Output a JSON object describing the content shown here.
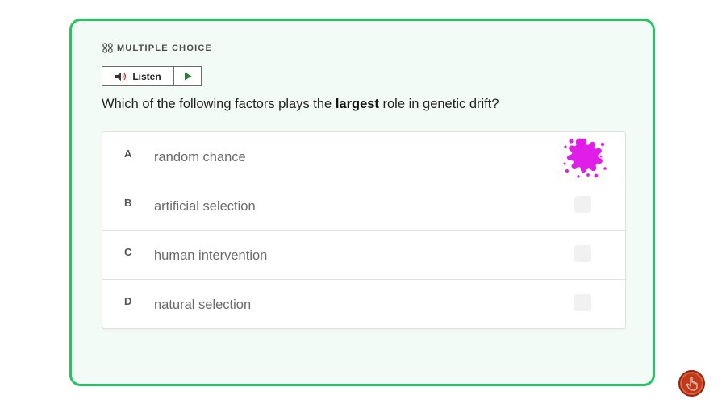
{
  "question_card": {
    "type_label": "MULTIPLE CHOICE",
    "type_icon": "grid-icon",
    "listen": {
      "label": "Listen",
      "speaker_icon": "speaker-icon",
      "play_icon": "play-icon"
    },
    "question": {
      "prefix": "Which of the following factors plays the ",
      "emphasis": "largest",
      "suffix": " role in genetic drift?"
    },
    "options": [
      {
        "letter": "A",
        "text": "random chance",
        "state": "splat-marked"
      },
      {
        "letter": "B",
        "text": "artificial selection",
        "state": "unchecked"
      },
      {
        "letter": "C",
        "text": "human intervention",
        "state": "unchecked"
      },
      {
        "letter": "D",
        "text": "natural selection",
        "state": "unchecked"
      }
    ]
  },
  "floating_button": {
    "icon": "hand-pointer-icon"
  },
  "colors": {
    "card_border": "#22c55e",
    "card_background": "#f2fbf5",
    "splat": "#e01ee8",
    "floating_button": "#c0391b",
    "play_icon": "#2e7d32"
  }
}
